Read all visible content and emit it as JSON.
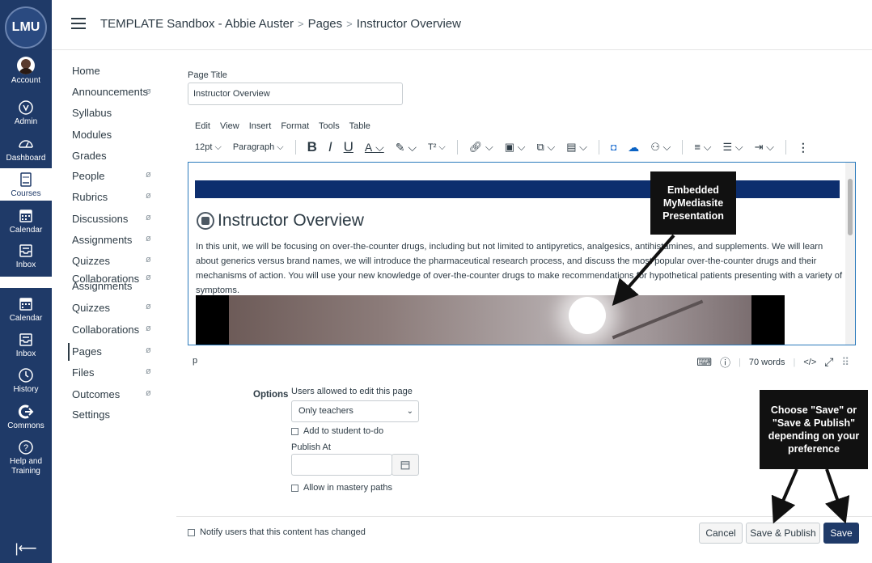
{
  "global_nav": {
    "logo": "LMU",
    "items": [
      {
        "label": "Account",
        "icon": "avatar-icon"
      },
      {
        "label": "Admin",
        "icon": "shield-icon"
      },
      {
        "label": "Dashboard",
        "icon": "dashboard-icon"
      },
      {
        "label": "Courses",
        "icon": "book-icon"
      },
      {
        "label": "Calendar",
        "icon": "calendar-icon"
      },
      {
        "label": "Inbox",
        "icon": "inbox-icon"
      },
      {
        "label": "Calendar",
        "icon": "calendar-icon"
      },
      {
        "label": "Inbox",
        "icon": "inbox-icon"
      },
      {
        "label": "History",
        "icon": "clock-icon"
      },
      {
        "label": "Commons",
        "icon": "commons-icon"
      },
      {
        "label": "Help and Training",
        "icon": "help-icon"
      }
    ],
    "collapse_icon": "collapse-icon"
  },
  "header": {
    "breadcrumb": [
      "TEMPLATE Sandbox - Abbie Auster",
      "Pages",
      "Instructor Overview"
    ],
    "separator": ">"
  },
  "course_nav": {
    "items": [
      {
        "label": "Home",
        "hidden": false
      },
      {
        "label": "Announcements",
        "hidden": true
      },
      {
        "label": "Syllabus",
        "hidden": false
      },
      {
        "label": "Modules",
        "hidden": false
      },
      {
        "label": "Grades",
        "hidden": false
      },
      {
        "label": "People",
        "hidden": true
      },
      {
        "label": "Rubrics",
        "hidden": true
      },
      {
        "label": "Discussions",
        "hidden": true
      },
      {
        "label": "Assignments",
        "hidden": true
      },
      {
        "label": "Quizzes",
        "hidden": true
      },
      {
        "label": "Collaborations",
        "hidden": true
      },
      {
        "label": "Assignments",
        "hidden": false
      },
      {
        "label": "Quizzes",
        "hidden": true
      },
      {
        "label": "Collaborations",
        "hidden": true
      },
      {
        "label": "Pages",
        "hidden": true
      },
      {
        "label": "Files",
        "hidden": true
      },
      {
        "label": "Outcomes",
        "hidden": true
      },
      {
        "label": "Settings",
        "hidden": false
      }
    ],
    "hidden_icon": "ø"
  },
  "page_title": {
    "label": "Page Title",
    "value": "Instructor Overview"
  },
  "editor": {
    "menu": [
      "Edit",
      "View",
      "Insert",
      "Format",
      "Tools",
      "Table"
    ],
    "font_size": "12pt",
    "block_format": "Paragraph",
    "heading": "Instructor Overview",
    "body": "In this unit, we will be focusing on over-the-counter drugs, including but not limited to antipyretics, analgesics, antihistamines, and supplements. We will learn about generics versus brand names, we will introduce the pharmaceutical research process, and discuss the most popular over-the-counter drugs and their mechanisms of action. You will use your new knowledge of over-the-counter drugs to make recommendations for hypothetical patients presenting with a variety of symptoms.",
    "status_element": "p",
    "word_count": "70 words",
    "html_toggle": "</>",
    "banner_color": "#0d2e6e"
  },
  "options": {
    "label": "Options",
    "edit_label": "Users allowed to edit this page",
    "edit_value": "Only teachers",
    "add_todo": "Add to student to-do",
    "publish_at_label": "Publish At",
    "publish_at_value": "",
    "mastery_paths": "Allow in mastery paths"
  },
  "footer": {
    "notify": "Notify users that this content has changed",
    "cancel": "Cancel",
    "save_publish": "Save & Publish",
    "save": "Save"
  },
  "annotations": {
    "embedded": "Embedded MyMediasite Presentation",
    "choose_save": "Choose \"Save\" or \"Save & Publish\" depending on your preference"
  },
  "colors": {
    "nav_bg": "#1f3a68",
    "primary_button": "#1f3a68"
  }
}
